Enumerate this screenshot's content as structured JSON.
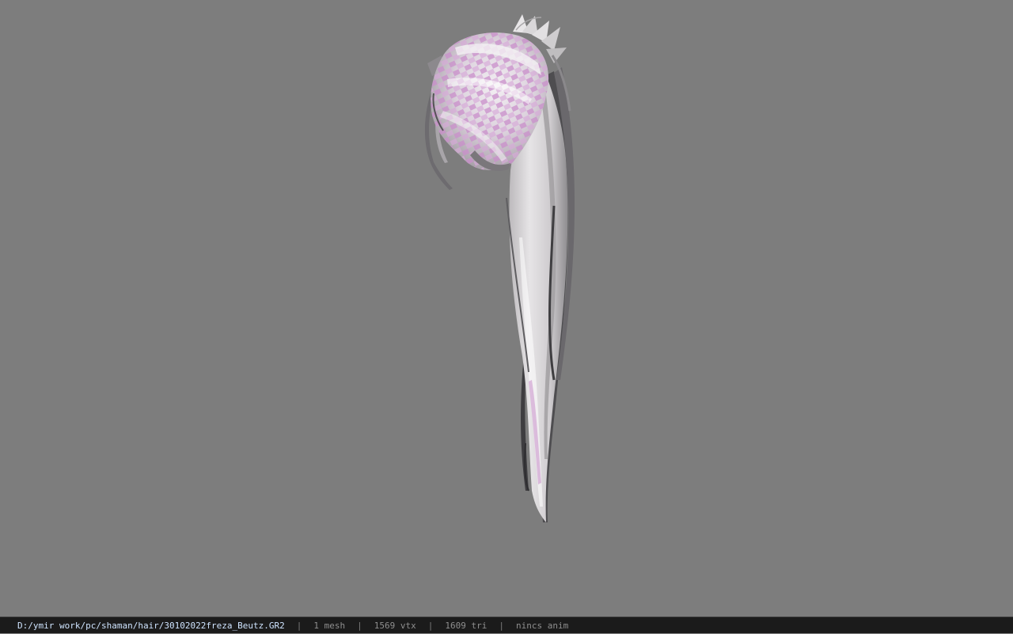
{
  "status_bar": {
    "file_path": "D:/ymir work/pc/shaman/hair/30102022freza_Beutz.GR2",
    "separator": "|",
    "mesh_count": "1 mesh",
    "vertex_count": "1569 vtx",
    "triangle_count": "1609 tri",
    "anim_status": "nincs anim"
  },
  "colors": {
    "viewport_background": "#7d7d7d",
    "statusbar_background": "#1b1b1b",
    "path_text": "#cfe4ff",
    "stat_text": "#8f8f8f",
    "hair_white": "#e4e2e4",
    "hair_pink": "#c98fcb",
    "hair_shadow": "#5a5a5c"
  }
}
